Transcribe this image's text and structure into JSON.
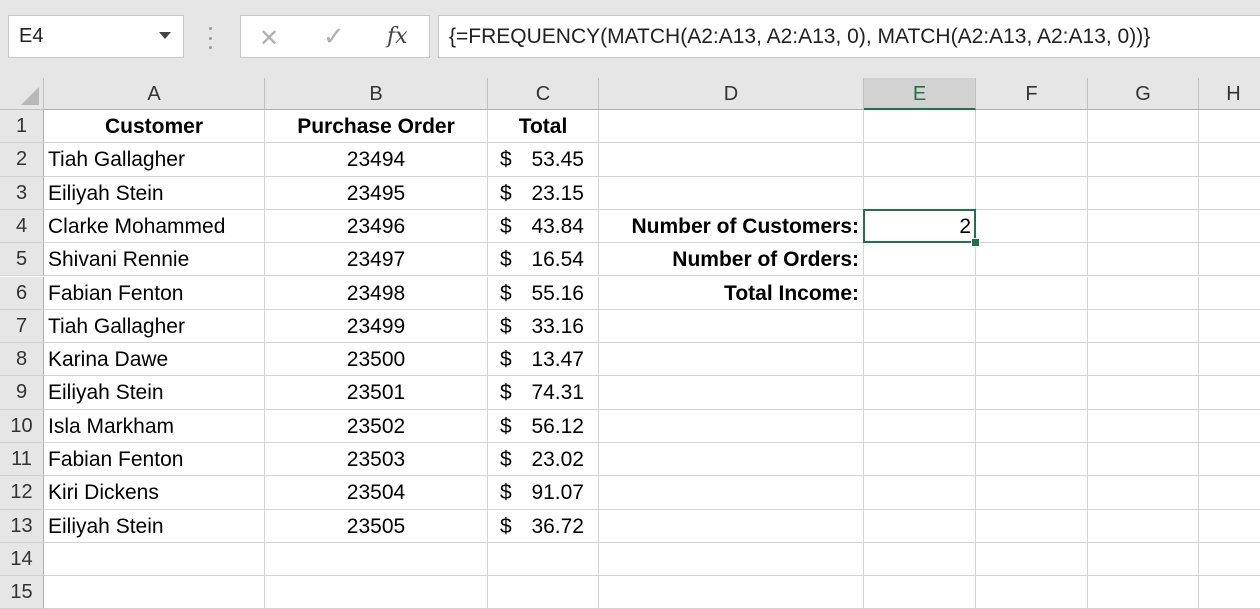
{
  "name_box": {
    "value": "E4"
  },
  "formula_bar": {
    "formula": "{=FREQUENCY(MATCH(A2:A13, A2:A13, 0), MATCH(A2:A13, A2:A13, 0))}",
    "cancel_icon": "cancel-x-icon",
    "enter_icon": "checkmark-icon",
    "fx_label": "fx"
  },
  "columns": [
    "A",
    "B",
    "C",
    "D",
    "E",
    "F",
    "G",
    "H"
  ],
  "rows": [
    "1",
    "2",
    "3",
    "4",
    "5",
    "6",
    "7",
    "8",
    "9",
    "10",
    "11",
    "12",
    "13",
    "14",
    "15"
  ],
  "selected_cell": "E4",
  "headers": {
    "customer": "Customer",
    "purchase_order": "Purchase Order",
    "total": "Total"
  },
  "table": [
    {
      "customer": "Tiah Gallagher",
      "order": "23494",
      "currency": "$",
      "total": "53.45"
    },
    {
      "customer": "Eiliyah Stein",
      "order": "23495",
      "currency": "$",
      "total": "23.15"
    },
    {
      "customer": "Clarke Mohammed",
      "order": "23496",
      "currency": "$",
      "total": "43.84"
    },
    {
      "customer": "Shivani Rennie",
      "order": "23497",
      "currency": "$",
      "total": "16.54"
    },
    {
      "customer": "Fabian Fenton",
      "order": "23498",
      "currency": "$",
      "total": "55.16"
    },
    {
      "customer": "Tiah Gallagher",
      "order": "23499",
      "currency": "$",
      "total": "33.16"
    },
    {
      "customer": "Karina Dawe",
      "order": "23500",
      "currency": "$",
      "total": "13.47"
    },
    {
      "customer": "Eiliyah Stein",
      "order": "23501",
      "currency": "$",
      "total": "74.31"
    },
    {
      "customer": "Isla Markham",
      "order": "23502",
      "currency": "$",
      "total": "56.12"
    },
    {
      "customer": "Fabian Fenton",
      "order": "23503",
      "currency": "$",
      "total": "23.02"
    },
    {
      "customer": "Kiri Dickens",
      "order": "23504",
      "currency": "$",
      "total": "91.07"
    },
    {
      "customer": "Eiliyah Stein",
      "order": "23505",
      "currency": "$",
      "total": "36.72"
    }
  ],
  "summary": {
    "customers_label": "Number of Customers:",
    "customers_value": "2",
    "orders_label": "Number of Orders:",
    "income_label": "Total Income:"
  },
  "colors": {
    "accent": "#217346",
    "header_bg": "#e6e6e6",
    "gridline": "#d4d4d4"
  }
}
